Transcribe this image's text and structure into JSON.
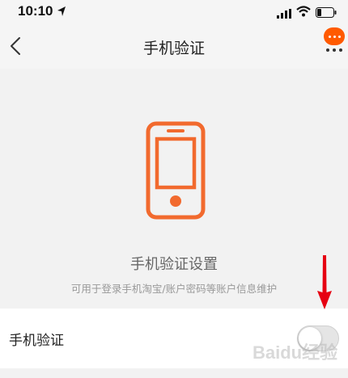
{
  "status_bar": {
    "time": "10:10",
    "icons": [
      "location-arrow-icon",
      "cellular-signal-icon",
      "wifi-icon",
      "battery-icon"
    ]
  },
  "nav": {
    "title": "手机验证",
    "back_icon": "chevron-left-icon",
    "message_icon": "chat-bubble-icon",
    "more_icon": "more-dots-icon"
  },
  "illustration": {
    "icon": "smartphone-icon"
  },
  "section": {
    "title": "手机验证设置",
    "description": "可用于登录手机淘宝/账户密码等账户信息维护"
  },
  "setting": {
    "label": "手机验证",
    "enabled": false
  },
  "annotation": {
    "icon": "red-arrow-icon"
  },
  "watermark": {
    "text": "Baidu经验"
  },
  "colors": {
    "accent": "#ff5a00",
    "phone_icon": "#f26a2e",
    "arrow": "#e60012",
    "background": "#f2f2f2"
  }
}
